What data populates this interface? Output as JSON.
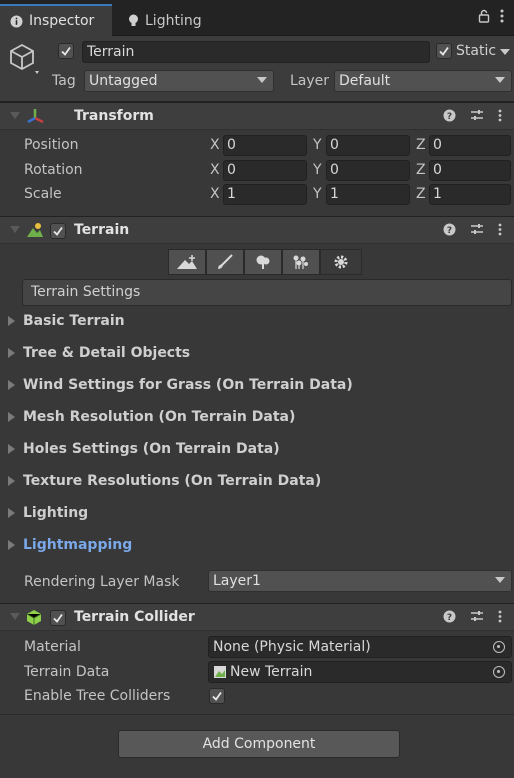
{
  "tabs": [
    {
      "label": "Inspector",
      "icon": "info-icon",
      "active": true
    },
    {
      "label": "Lighting",
      "icon": "bulb-icon",
      "active": false
    }
  ],
  "object": {
    "name": "Terrain",
    "static_label": "Static",
    "tag_label": "Tag",
    "tag_value": "Untagged",
    "layer_label": "Layer",
    "layer_value": "Default"
  },
  "transform": {
    "title": "Transform",
    "rows": [
      {
        "label": "Position",
        "x": "0",
        "y": "0",
        "z": "0"
      },
      {
        "label": "Rotation",
        "x": "0",
        "y": "0",
        "z": "0"
      },
      {
        "label": "Scale",
        "x": "1",
        "y": "1",
        "z": "1"
      }
    ],
    "axis": {
      "x": "X",
      "y": "Y",
      "z": "Z"
    }
  },
  "terrain": {
    "title": "Terrain",
    "settings_label": "Terrain Settings",
    "sections": [
      "Basic Terrain",
      "Tree & Detail Objects",
      "Wind Settings for Grass (On Terrain Data)",
      "Mesh Resolution (On Terrain Data)",
      "Holes Settings (On Terrain Data)",
      "Texture Resolutions (On Terrain Data)",
      "Lighting",
      "Lightmapping"
    ],
    "rendering_layer_label": "Rendering Layer Mask",
    "rendering_layer_value": "Layer1"
  },
  "collider": {
    "title": "Terrain Collider",
    "material_label": "Material",
    "material_value": "None (Physic Material)",
    "terrain_data_label": "Terrain Data",
    "terrain_data_value": "New Terrain",
    "tree_colliders_label": "Enable Tree Colliders"
  },
  "add_component_label": "Add Component",
  "colors": {
    "accent": "#3a79bb",
    "link": "#7aa8e8",
    "background": "#383838"
  }
}
